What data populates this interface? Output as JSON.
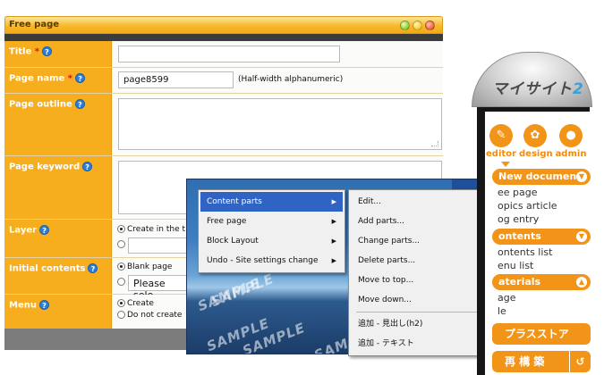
{
  "form_window": {
    "title": "Free page",
    "fields": {
      "title": {
        "label": "Title",
        "required_mark": "*",
        "value": ""
      },
      "page_name": {
        "label": "Page name",
        "required_mark": "*",
        "value": "page8599",
        "note": "(Half-width alphanumeric)"
      },
      "page_outline": {
        "label": "Page outline",
        "value": ""
      },
      "page_keyword": {
        "label": "Page keyword",
        "value": ""
      },
      "layer": {
        "label": "Layer",
        "option1": "Create in the t",
        "option2": ""
      },
      "initial_contents": {
        "label": "Initial contents",
        "option1": "Blank page",
        "select_value": "Please sele"
      },
      "menu": {
        "label": "Menu",
        "option1": "Create",
        "option2": "Do not create"
      }
    },
    "help_glyph": "?"
  },
  "preview": {
    "watermark": "SAMPLE"
  },
  "context_menu": {
    "items": [
      {
        "label": "Content parts",
        "highlighted": true
      },
      {
        "label": "Free page"
      },
      {
        "label": "Block Layout"
      },
      {
        "label": "Undo - Site settings change"
      }
    ],
    "arrow": "▶"
  },
  "submenu": {
    "items": [
      "Edit...",
      "Add parts...",
      "Change parts...",
      "Delete parts...",
      "Move to top...",
      "Move down...",
      "追加 - 見出し(h2)",
      "追加 - テキスト"
    ]
  },
  "sidebar": {
    "logo": "マイサイト",
    "logo_num": "2",
    "tools": [
      {
        "label": "editor",
        "icon": "✎"
      },
      {
        "label": "design",
        "icon": "✿"
      },
      {
        "label": "admin",
        "icon": "●"
      }
    ],
    "sections": [
      {
        "header": "New documen",
        "items": [
          "ee page",
          "opics article",
          "og entry"
        ]
      },
      {
        "header": "ontents",
        "items": [
          "ontents list",
          "enu list"
        ]
      },
      {
        "header": "aterials",
        "items": [
          "age",
          "le"
        ]
      }
    ],
    "store_button": "プラスストア",
    "rebuild_button": "再 構 築",
    "rebuild_sub": "↺",
    "accent_color": "#f29417"
  }
}
